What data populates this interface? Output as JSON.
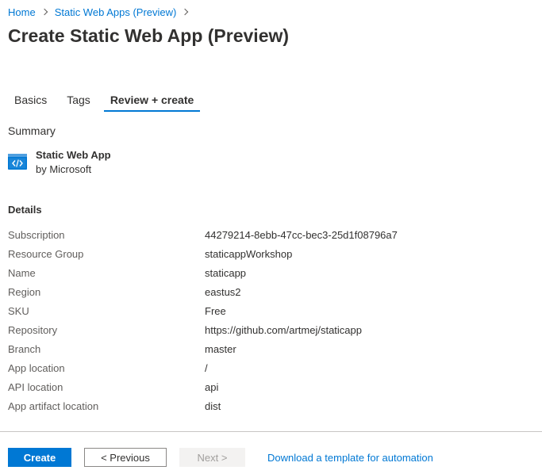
{
  "breadcrumb": {
    "items": [
      {
        "label": "Home"
      },
      {
        "label": "Static Web Apps (Preview)"
      }
    ]
  },
  "page": {
    "title": "Create Static Web App (Preview)"
  },
  "tabs": [
    {
      "label": "Basics",
      "active": false
    },
    {
      "label": "Tags",
      "active": false
    },
    {
      "label": "Review + create",
      "active": true
    }
  ],
  "summary": {
    "label": "Summary",
    "product_name": "Static Web App",
    "publisher": "by Microsoft",
    "icon": "static-web-app-icon"
  },
  "details": {
    "heading": "Details",
    "rows": [
      {
        "label": "Subscription",
        "value": "44279214-8ebb-47cc-bec3-25d1f08796a7"
      },
      {
        "label": "Resource Group",
        "value": "staticappWorkshop"
      },
      {
        "label": "Name",
        "value": "staticapp"
      },
      {
        "label": "Region",
        "value": "eastus2"
      },
      {
        "label": "SKU",
        "value": "Free"
      },
      {
        "label": "Repository",
        "value": "https://github.com/artmej/staticapp"
      },
      {
        "label": "Branch",
        "value": "master"
      },
      {
        "label": "App location",
        "value": "/"
      },
      {
        "label": "API location",
        "value": "api"
      },
      {
        "label": "App artifact location",
        "value": "dist"
      }
    ]
  },
  "footer": {
    "create_label": "Create",
    "previous_label": "< Previous",
    "next_label": "Next >",
    "download_link": "Download a template for automation"
  },
  "colors": {
    "accent": "#0078d4",
    "text": "#323130",
    "label_text": "#605e5c",
    "disabled_bg": "#f3f2f1",
    "disabled_text": "#a19f9d"
  }
}
